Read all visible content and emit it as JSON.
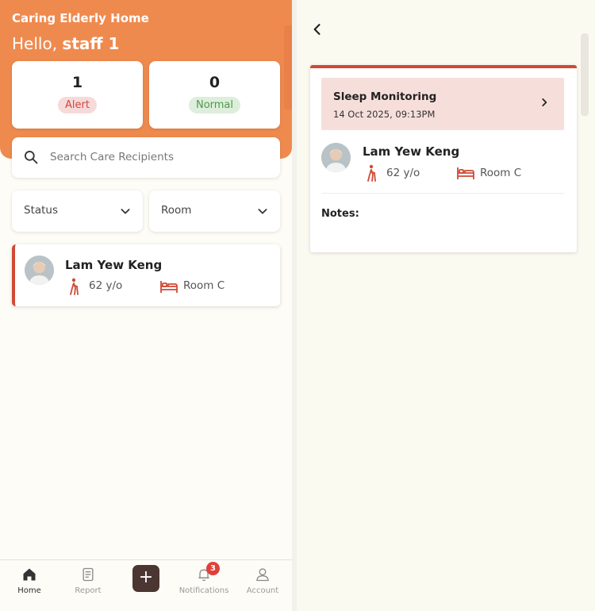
{
  "app": {
    "title": "Caring Elderly Home"
  },
  "greeting": {
    "prefix": "Hello, ",
    "user": "staff 1"
  },
  "stats": [
    {
      "count": "1",
      "label": "Alert"
    },
    {
      "count": "0",
      "label": "Normal"
    }
  ],
  "search": {
    "placeholder": "Search Care Recipients",
    "value": ""
  },
  "filters": {
    "status": "Status",
    "room": "Room"
  },
  "recipients": [
    {
      "name": "Lam Yew Keng",
      "age": "62 y/o",
      "room": "Room C"
    }
  ],
  "nav": {
    "items": [
      {
        "label": "Home",
        "icon": "home-icon"
      },
      {
        "label": "Report",
        "icon": "report-icon"
      },
      {
        "label": "+",
        "icon": "plus-icon"
      },
      {
        "label": "Notifications",
        "icon": "bell-icon",
        "badge": "3"
      },
      {
        "label": "Account",
        "icon": "user-icon"
      }
    ]
  },
  "detail": {
    "event_title": "Sleep Monitoring",
    "event_time": "14 Oct 2025, 09:13PM",
    "name": "Lam Yew Keng",
    "age": "62 y/o",
    "room": "Room C",
    "notes_label": "Notes:"
  },
  "colors": {
    "accent": "#ef8a4f",
    "alert": "#d04a36",
    "normal": "#4b9a4a"
  }
}
